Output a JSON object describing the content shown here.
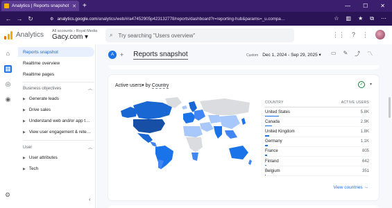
{
  "browser": {
    "tab_title": "Analytics | Reports snapshot",
    "url_host": "analytics.google.com",
    "url_path": "/analytics/web/#/a47452905p423132778/reports/dashboard?r=reporting-hub&params=_u.compa…"
  },
  "header": {
    "app_name": "Analytics",
    "breadcrumb": "All accounts › Royal Media",
    "property": "Gacy.com ▾",
    "search_placeholder": "Try searching \"Users overview\""
  },
  "sidebar": {
    "items": [
      {
        "label": "Reports snapshot"
      },
      {
        "label": "Realtime overview"
      },
      {
        "label": "Realtime pages"
      }
    ],
    "sections": [
      {
        "label": "Business objectives",
        "items": [
          "Generate leads",
          "Drive sales",
          "Understand web and/or app t…",
          "View user engagement & rete…"
        ]
      },
      {
        "label": "User",
        "items": [
          "User attributes",
          "Tech"
        ]
      }
    ]
  },
  "main": {
    "avatar_letter": "A",
    "page_title": "Reports snapshot",
    "date_label": "Custom",
    "date_range": "Dec 1, 2024 - Sep 29, 2025 ▾"
  },
  "card": {
    "title_metric": "Active users",
    "title_by": "▾ by ",
    "title_dim": "Country",
    "col_country": "COUNTRY",
    "col_users": "ACTIVE USERS",
    "view_link": "View countries →"
  },
  "chart_data": {
    "type": "table",
    "columns": [
      "COUNTRY",
      "ACTIVE USERS"
    ],
    "rows": [
      {
        "country": "United States",
        "users": "5.8K",
        "value": 5800
      },
      {
        "country": "Canada",
        "users": "2.9K",
        "value": 2900
      },
      {
        "country": "United Kingdom",
        "users": "1.8K",
        "value": 1800
      },
      {
        "country": "Germany",
        "users": "1.1K",
        "value": 1100
      },
      {
        "country": "France",
        "users": "805",
        "value": 805
      },
      {
        "country": "Finland",
        "users": "642",
        "value": 642
      },
      {
        "country": "Belgium",
        "users": "351",
        "value": 351
      }
    ]
  },
  "colors": {
    "primary": "#1a73e8",
    "chrome": "#3c1e6e",
    "map_dark": "#1967d2",
    "map_mid": "#4285f4",
    "map_light": "#a8c7fa",
    "map_none": "#dadce0"
  }
}
